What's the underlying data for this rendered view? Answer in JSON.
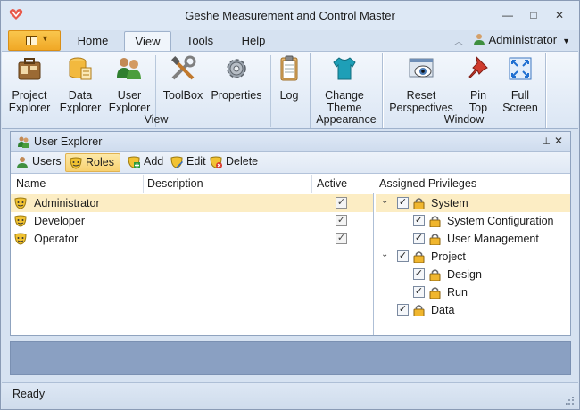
{
  "window": {
    "title": "Geshe Measurement and Control Master",
    "minimize": "—",
    "maximize": "□",
    "close": "✕"
  },
  "tabs": [
    "Home",
    "View",
    "Tools",
    "Help"
  ],
  "active_tab": "View",
  "user": {
    "name": "Administrator"
  },
  "ribbon": {
    "view_group": {
      "label": "View",
      "buttons": [
        {
          "line1": "Project",
          "line2": "Explorer",
          "icon": "briefcase-icon"
        },
        {
          "line1": "Data",
          "line2": "Explorer",
          "icon": "database-icon"
        },
        {
          "line1": "User",
          "line2": "Explorer",
          "icon": "users-icon"
        },
        {
          "line1": "ToolBox",
          "line2": "",
          "icon": "tools-icon"
        },
        {
          "line1": "Properties",
          "line2": "",
          "icon": "gear-icon"
        },
        {
          "line1": "Log",
          "line2": "",
          "icon": "clipboard-icon"
        }
      ]
    },
    "appearance_group": {
      "label": "Appearance",
      "buttons": [
        {
          "line1": "Change",
          "line2": "Theme",
          "icon": "tshirt-icon"
        }
      ]
    },
    "window_group": {
      "label": "Window",
      "buttons": [
        {
          "line1": "Reset",
          "line2": "Perspectives",
          "icon": "eye-window-icon"
        },
        {
          "line1": "Pin",
          "line2": "Top",
          "icon": "pushpin-icon"
        },
        {
          "line1": "Full",
          "line2": "Screen",
          "icon": "fullscreen-icon"
        }
      ]
    }
  },
  "panel": {
    "title": "User Explorer",
    "pin": "⊥",
    "close": "✕",
    "toolbar": {
      "users": "Users",
      "roles": "Roles",
      "add": "Add",
      "edit": "Edit",
      "delete": "Delete"
    },
    "columns": {
      "name": "Name",
      "description": "Description",
      "active": "Active"
    },
    "rows": [
      {
        "name": "Administrator",
        "description": "",
        "active": true,
        "selected": true
      },
      {
        "name": "Developer",
        "description": "",
        "active": true,
        "selected": false
      },
      {
        "name": "Operator",
        "description": "",
        "active": true,
        "selected": false
      }
    ],
    "privileges_header": "Assigned Privileges",
    "privileges": [
      {
        "label": "System",
        "level": 0,
        "expander": "⌄",
        "checked": true,
        "selected": true
      },
      {
        "label": "System Configuration",
        "level": 1,
        "expander": "",
        "checked": true,
        "selected": false
      },
      {
        "label": "User Management",
        "level": 1,
        "expander": "",
        "checked": true,
        "selected": false
      },
      {
        "label": "Project",
        "level": 0,
        "expander": "⌄",
        "checked": true,
        "selected": false
      },
      {
        "label": "Design",
        "level": 1,
        "expander": "",
        "checked": true,
        "selected": false
      },
      {
        "label": "Run",
        "level": 1,
        "expander": "",
        "checked": true,
        "selected": false
      },
      {
        "label": "Data",
        "level": 0,
        "expander": "",
        "checked": true,
        "selected": false
      }
    ]
  },
  "status": {
    "text": "Ready"
  },
  "colors": {
    "accent": "#f0a826",
    "selection": "#fcedc4",
    "band": "#8aa0c2"
  }
}
